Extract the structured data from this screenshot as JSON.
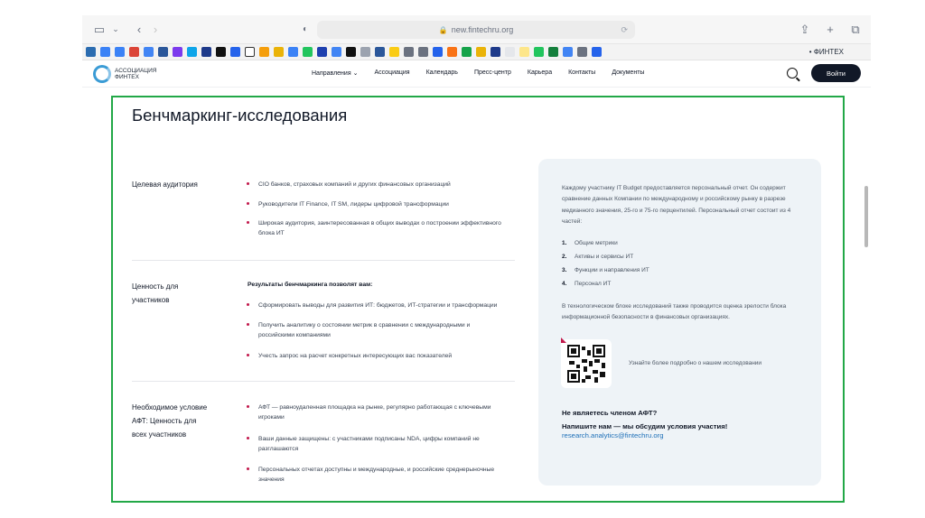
{
  "browser": {
    "url": "new.fintechru.org",
    "bookmark_brand": "• ФИНТЕХ"
  },
  "nav": {
    "logo_text": "АССОЦИАЦИЯ ФИНТЕХ",
    "items": [
      "Направления ⌄",
      "Ассоциация",
      "Календарь",
      "Пресс-центр",
      "Карьера",
      "Контакты",
      "Документы"
    ],
    "login": "Войти"
  },
  "page": {
    "title": "Бенчмаркинг-исследования",
    "sections": [
      {
        "label": "Целевая аудитория",
        "bullets": [
          "CIO банков, страховых компаний и других финансовых организаций",
          "Руководители IT Finance, IT SM, лидеры цифровой трансформации",
          "Широкая аудитория, заинтересованная в общих выводах о построении эффективного блока ИТ"
        ]
      },
      {
        "label": "Ценность для участников",
        "intro": "Результаты бенчмаркинга позволят вам:",
        "bullets": [
          "Сформировать выводы для развития ИТ: бюджетов, ИТ-стратегии и трансформации",
          "Получить аналитику о состоянии метрик в сравнении с международными и российскими компаниями",
          "Учесть запрос на расчет конкретных интересующих вас показателей"
        ]
      },
      {
        "label": "Необходимое условие АФТ: Ценность для всех участников",
        "bullets": [
          "АФТ — равноудаленная площадка на рынке, регулярно работающая с ключевыми игроками",
          "Ваши данные защищены: с участниками подписаны NDA, цифры компаний не разглашаются",
          "Персональных отчетах доступны и международные, и российские среднерыночные значения"
        ]
      }
    ],
    "panel": {
      "text1": "Каждому участнику IT Budget предоставляется персональный отчет. Он содержит сравнение данных Компании по международному и российскому рынку в разрезе медианного значения, 25-го и 75-го перцентилей. Персональный отчет состоит из 4 частей:",
      "list": [
        "Общие метрики",
        "Активы и сервисы ИТ",
        "Функции и направления ИТ",
        "Персонал ИТ"
      ],
      "text2": "В технологическом блоке исследований также проводится оценка зрелости блока информационной безопасности в финансовых организациях.",
      "qr_caption": "Узнайте более подробно о нашем исследовании",
      "cta_line1": "Не являетесь членом АФТ?",
      "cta_line2": "Напишите нам — мы обсудим условия участия!",
      "email": "research.analytics@fintechru.org"
    }
  }
}
